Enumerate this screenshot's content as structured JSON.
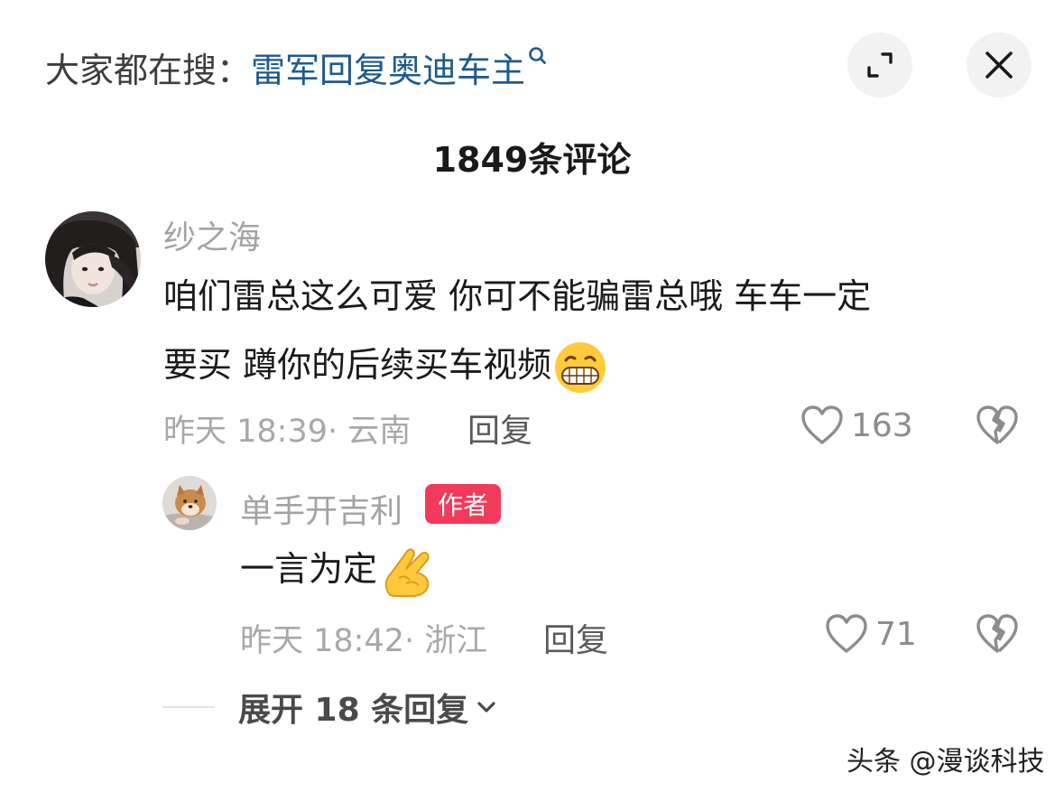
{
  "header": {
    "search_prefix": "大家都在搜：",
    "search_query": "雷军回复奥迪车主",
    "count_title": "1849条评论"
  },
  "comment": {
    "username": "纱之海",
    "text_line1": "咱们雷总这么可爱  你可不能骗雷总哦  车车一定",
    "text_line2": "要买  蹲你的后续买车视频",
    "meta": "昨天 18:39· 云南",
    "reply_label": "回复",
    "likes": "163"
  },
  "reply": {
    "username": "单手开吉利",
    "badge": "作者",
    "text": "一言为定",
    "meta": "昨天 18:42· 浙江",
    "reply_label": "回复",
    "likes": "71"
  },
  "expand": {
    "label": "展开 18 条回复"
  },
  "watermark": "头条 @漫谈科技",
  "icons": {
    "search": "search-icon",
    "expand": "expand-icon",
    "close": "close-icon",
    "like": "heart-icon",
    "dislike": "broken-heart-icon",
    "chevron": "chevron-down-icon"
  },
  "colors": {
    "query": "#1e5a8c",
    "badge": "#f33a5a",
    "muted": "#a8a8a8"
  }
}
